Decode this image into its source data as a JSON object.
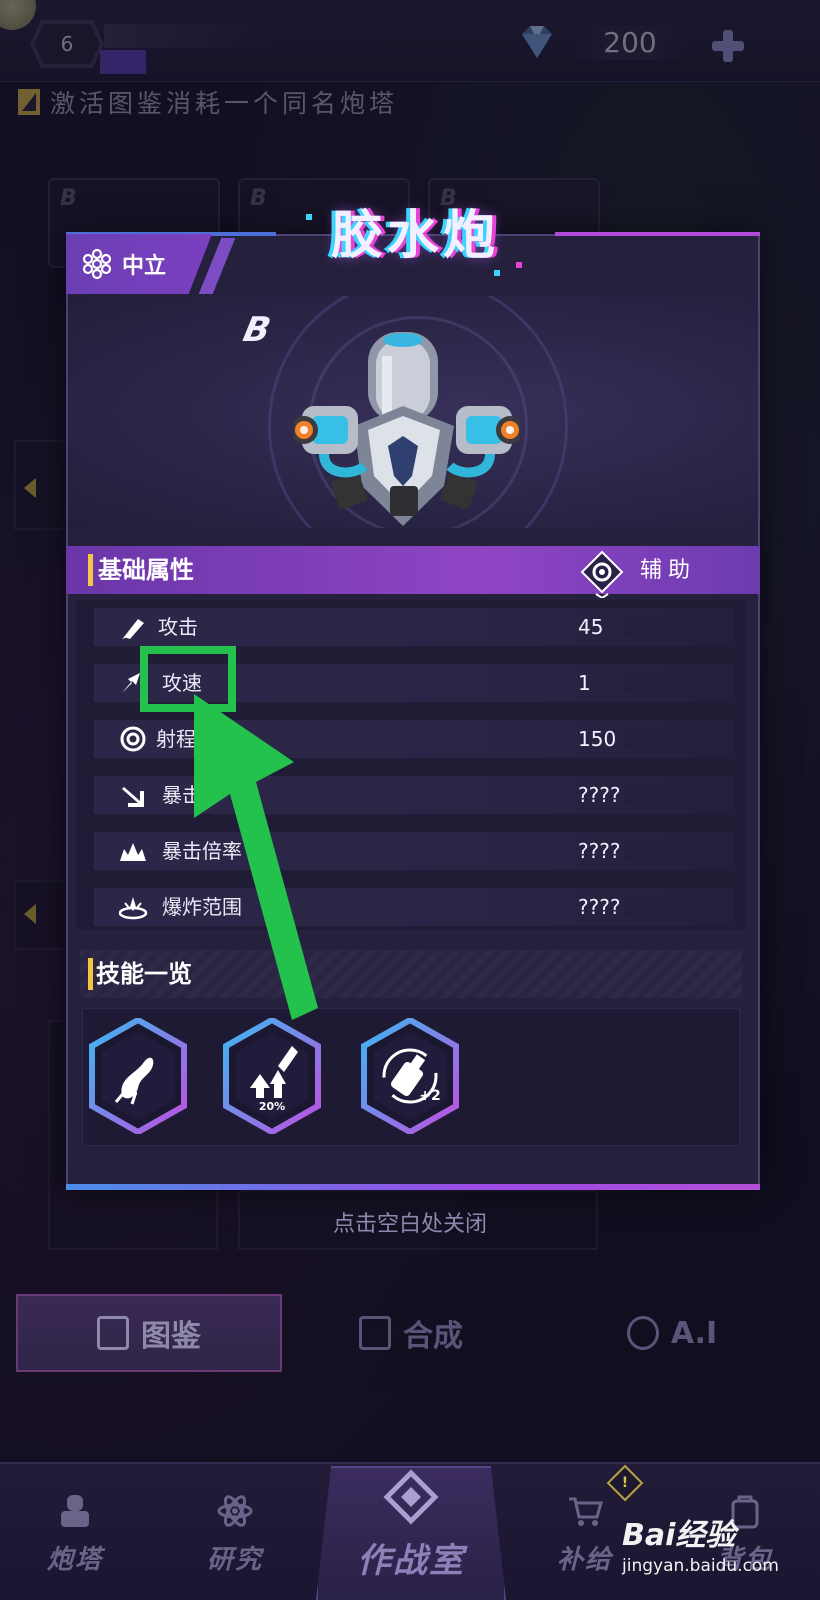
{
  "topbar": {
    "level": "6",
    "gem_count": "200"
  },
  "hint": "激活图鉴消耗一个同名炮塔",
  "background_cards": [
    "B",
    "B",
    "B"
  ],
  "modal": {
    "faction": "中立",
    "title": "胶水炮",
    "grade": "B",
    "section_title": "基础属性",
    "role": "辅助",
    "stats": [
      {
        "icon": "attack-icon",
        "label": "攻击",
        "value": "45"
      },
      {
        "icon": "attack-speed-icon",
        "label": "攻速",
        "value": "1"
      },
      {
        "icon": "range-icon",
        "label": "射程",
        "value": "150"
      },
      {
        "icon": "crit-icon",
        "label": "暴击",
        "value": "????"
      },
      {
        "icon": "crit-multiplier-icon",
        "label": "暴击倍率",
        "value": "????"
      },
      {
        "icon": "explosion-icon",
        "label": "爆炸范围",
        "value": "????"
      }
    ],
    "skills_title": "技能一览",
    "skill_icons": [
      "glue-splash-icon",
      "speed-boost-icon",
      "glue-bottle-icon"
    ],
    "skill_badges": [
      "20%",
      "+2"
    ],
    "close_hint": "点击空白处关闭"
  },
  "tabs": [
    {
      "label": "图鉴",
      "icon": "codex-icon",
      "active": true
    },
    {
      "label": "合成",
      "icon": "merge-icon",
      "active": false
    },
    {
      "label": "A.I",
      "icon": "ai-chip-icon",
      "active": false
    }
  ],
  "nav": [
    {
      "label": "炮塔",
      "icon": "turret-icon"
    },
    {
      "label": "研究",
      "icon": "atom-icon"
    },
    {
      "label": "作战室",
      "icon": "war-room-icon"
    },
    {
      "label": "补给",
      "icon": "cart-icon"
    },
    {
      "label": "背包",
      "icon": "bag-icon"
    }
  ],
  "nav_alert": "!",
  "watermark": {
    "logo": "Bai经验",
    "url": "jingyan.baidu.com"
  },
  "colors": {
    "accent_purple": "#8f45c4",
    "highlight_green": "#22c24c",
    "gold": "#f2c744"
  }
}
